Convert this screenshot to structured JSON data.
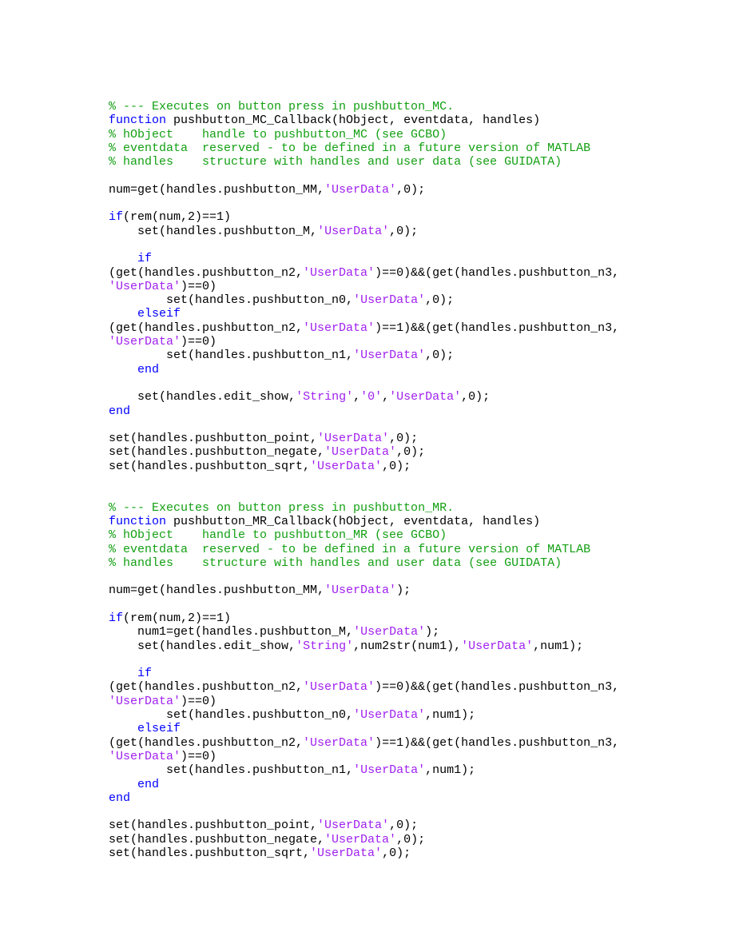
{
  "document": {
    "language": "MATLAB",
    "colors": {
      "background": "#ffffff",
      "plain": "#000000",
      "comment": "#13a013",
      "keyword": "#0000ff",
      "string": "#a020f0"
    }
  },
  "lines": [
    {
      "id": 1,
      "indent": "",
      "segments": [
        {
          "t": "comment",
          "s": "% --- Executes on button press in pushbutton_MC."
        }
      ]
    },
    {
      "id": 2,
      "indent": "",
      "segments": [
        {
          "t": "keyword",
          "s": "function"
        },
        {
          "t": "plain",
          "s": " pushbutton_MC_Callback(hObject, eventdata, handles)"
        }
      ]
    },
    {
      "id": 3,
      "indent": "",
      "segments": [
        {
          "t": "comment",
          "s": "% hObject    handle to pushbutton_MC (see GCBO)"
        }
      ]
    },
    {
      "id": 4,
      "indent": "",
      "segments": [
        {
          "t": "comment",
          "s": "% eventdata  reserved - to be defined in a future version of MATLAB"
        }
      ]
    },
    {
      "id": 5,
      "indent": "",
      "segments": [
        {
          "t": "comment",
          "s": "% handles    structure with handles and user data (see GUIDATA)"
        }
      ]
    },
    {
      "id": 6,
      "indent": "",
      "blank": true,
      "segments": [
        {
          "t": "plain",
          "s": ""
        }
      ]
    },
    {
      "id": 7,
      "indent": "",
      "segments": [
        {
          "t": "plain",
          "s": "num=get(handles.pushbutton_MM,"
        },
        {
          "t": "string",
          "s": "'UserData'"
        },
        {
          "t": "plain",
          "s": ",0);"
        }
      ]
    },
    {
      "id": 8,
      "indent": "",
      "blank": true,
      "segments": [
        {
          "t": "plain",
          "s": ""
        }
      ]
    },
    {
      "id": 9,
      "indent": "",
      "segments": [
        {
          "t": "keyword",
          "s": "if"
        },
        {
          "t": "plain",
          "s": "(rem(num,2)==1)"
        }
      ]
    },
    {
      "id": 10,
      "indent": "    ",
      "segments": [
        {
          "t": "plain",
          "s": "set(handles.pushbutton_M,"
        },
        {
          "t": "string",
          "s": "'UserData'"
        },
        {
          "t": "plain",
          "s": ",0);"
        }
      ]
    },
    {
      "id": 11,
      "indent": "",
      "blank": true,
      "segments": [
        {
          "t": "plain",
          "s": ""
        }
      ]
    },
    {
      "id": 12,
      "indent": "    ",
      "segments": [
        {
          "t": "keyword",
          "s": "if"
        }
      ]
    },
    {
      "id": 13,
      "indent": "",
      "segments": [
        {
          "t": "plain",
          "s": "(get(handles.pushbutton_n2,"
        },
        {
          "t": "string",
          "s": "'UserData'"
        },
        {
          "t": "plain",
          "s": ")==0)&&(get(handles.pushbutton_n3,"
        }
      ]
    },
    {
      "id": 14,
      "indent": "",
      "segments": [
        {
          "t": "string",
          "s": "'UserData'"
        },
        {
          "t": "plain",
          "s": ")==0)"
        }
      ]
    },
    {
      "id": 15,
      "indent": "        ",
      "segments": [
        {
          "t": "plain",
          "s": "set(handles.pushbutton_n0,"
        },
        {
          "t": "string",
          "s": "'UserData'"
        },
        {
          "t": "plain",
          "s": ",0);"
        }
      ]
    },
    {
      "id": 16,
      "indent": "    ",
      "segments": [
        {
          "t": "keyword",
          "s": "elseif"
        }
      ]
    },
    {
      "id": 17,
      "indent": "",
      "segments": [
        {
          "t": "plain",
          "s": "(get(handles.pushbutton_n2,"
        },
        {
          "t": "string",
          "s": "'UserData'"
        },
        {
          "t": "plain",
          "s": ")==1)&&(get(handles.pushbutton_n3,"
        }
      ]
    },
    {
      "id": 18,
      "indent": "",
      "segments": [
        {
          "t": "string",
          "s": "'UserData'"
        },
        {
          "t": "plain",
          "s": ")==0)"
        }
      ]
    },
    {
      "id": 19,
      "indent": "        ",
      "segments": [
        {
          "t": "plain",
          "s": "set(handles.pushbutton_n1,"
        },
        {
          "t": "string",
          "s": "'UserData'"
        },
        {
          "t": "plain",
          "s": ",0);"
        }
      ]
    },
    {
      "id": 20,
      "indent": "    ",
      "segments": [
        {
          "t": "keyword",
          "s": "end"
        }
      ]
    },
    {
      "id": 21,
      "indent": "",
      "blank": true,
      "segments": [
        {
          "t": "plain",
          "s": ""
        }
      ]
    },
    {
      "id": 22,
      "indent": "    ",
      "segments": [
        {
          "t": "plain",
          "s": "set(handles.edit_show,"
        },
        {
          "t": "string",
          "s": "'String'"
        },
        {
          "t": "plain",
          "s": ","
        },
        {
          "t": "string",
          "s": "'0'"
        },
        {
          "t": "plain",
          "s": ","
        },
        {
          "t": "string",
          "s": "'UserData'"
        },
        {
          "t": "plain",
          "s": ",0);"
        }
      ]
    },
    {
      "id": 23,
      "indent": "",
      "segments": [
        {
          "t": "keyword",
          "s": "end"
        }
      ]
    },
    {
      "id": 24,
      "indent": "",
      "blank": true,
      "segments": [
        {
          "t": "plain",
          "s": ""
        }
      ]
    },
    {
      "id": 25,
      "indent": "",
      "segments": [
        {
          "t": "plain",
          "s": "set(handles.pushbutton_point,"
        },
        {
          "t": "string",
          "s": "'UserData'"
        },
        {
          "t": "plain",
          "s": ",0);"
        }
      ]
    },
    {
      "id": 26,
      "indent": "",
      "segments": [
        {
          "t": "plain",
          "s": "set(handles.pushbutton_negate,"
        },
        {
          "t": "string",
          "s": "'UserData'"
        },
        {
          "t": "plain",
          "s": ",0);"
        }
      ]
    },
    {
      "id": 27,
      "indent": "",
      "segments": [
        {
          "t": "plain",
          "s": "set(handles.pushbutton_sqrt,"
        },
        {
          "t": "string",
          "s": "'UserData'"
        },
        {
          "t": "plain",
          "s": ",0);"
        }
      ]
    },
    {
      "id": 28,
      "indent": "",
      "blank": true,
      "segments": [
        {
          "t": "plain",
          "s": ""
        }
      ]
    },
    {
      "id": 29,
      "indent": "",
      "blank": true,
      "segments": [
        {
          "t": "plain",
          "s": ""
        }
      ]
    },
    {
      "id": 30,
      "indent": "",
      "segments": [
        {
          "t": "comment",
          "s": "% --- Executes on button press in pushbutton_MR."
        }
      ]
    },
    {
      "id": 31,
      "indent": "",
      "segments": [
        {
          "t": "keyword",
          "s": "function"
        },
        {
          "t": "plain",
          "s": " pushbutton_MR_Callback(hObject, eventdata, handles)"
        }
      ]
    },
    {
      "id": 32,
      "indent": "",
      "segments": [
        {
          "t": "comment",
          "s": "% hObject    handle to pushbutton_MR (see GCBO)"
        }
      ]
    },
    {
      "id": 33,
      "indent": "",
      "segments": [
        {
          "t": "comment",
          "s": "% eventdata  reserved - to be defined in a future version of MATLAB"
        }
      ]
    },
    {
      "id": 34,
      "indent": "",
      "segments": [
        {
          "t": "comment",
          "s": "% handles    structure with handles and user data (see GUIDATA)"
        }
      ]
    },
    {
      "id": 35,
      "indent": "",
      "blank": true,
      "segments": [
        {
          "t": "plain",
          "s": ""
        }
      ]
    },
    {
      "id": 36,
      "indent": "",
      "segments": [
        {
          "t": "plain",
          "s": "num=get(handles.pushbutton_MM,"
        },
        {
          "t": "string",
          "s": "'UserData'"
        },
        {
          "t": "plain",
          "s": ");"
        }
      ]
    },
    {
      "id": 37,
      "indent": "",
      "blank": true,
      "segments": [
        {
          "t": "plain",
          "s": ""
        }
      ]
    },
    {
      "id": 38,
      "indent": "",
      "segments": [
        {
          "t": "keyword",
          "s": "if"
        },
        {
          "t": "plain",
          "s": "(rem(num,2)==1)"
        }
      ]
    },
    {
      "id": 39,
      "indent": "    ",
      "segments": [
        {
          "t": "plain",
          "s": "num1=get(handles.pushbutton_M,"
        },
        {
          "t": "string",
          "s": "'UserData'"
        },
        {
          "t": "plain",
          "s": ");"
        }
      ]
    },
    {
      "id": 40,
      "indent": "    ",
      "segments": [
        {
          "t": "plain",
          "s": "set(handles.edit_show,"
        },
        {
          "t": "string",
          "s": "'String'"
        },
        {
          "t": "plain",
          "s": ",num2str(num1),"
        },
        {
          "t": "string",
          "s": "'UserData'"
        },
        {
          "t": "plain",
          "s": ",num1);"
        }
      ]
    },
    {
      "id": 41,
      "indent": "",
      "blank": true,
      "segments": [
        {
          "t": "plain",
          "s": ""
        }
      ]
    },
    {
      "id": 42,
      "indent": "    ",
      "segments": [
        {
          "t": "keyword",
          "s": "if"
        }
      ]
    },
    {
      "id": 43,
      "indent": "",
      "segments": [
        {
          "t": "plain",
          "s": "(get(handles.pushbutton_n2,"
        },
        {
          "t": "string",
          "s": "'UserData'"
        },
        {
          "t": "plain",
          "s": ")==0)&&(get(handles.pushbutton_n3,"
        }
      ]
    },
    {
      "id": 44,
      "indent": "",
      "segments": [
        {
          "t": "string",
          "s": "'UserData'"
        },
        {
          "t": "plain",
          "s": ")==0)"
        }
      ]
    },
    {
      "id": 45,
      "indent": "        ",
      "segments": [
        {
          "t": "plain",
          "s": "set(handles.pushbutton_n0,"
        },
        {
          "t": "string",
          "s": "'UserData'"
        },
        {
          "t": "plain",
          "s": ",num1);"
        }
      ]
    },
    {
      "id": 46,
      "indent": "    ",
      "segments": [
        {
          "t": "keyword",
          "s": "elseif"
        }
      ]
    },
    {
      "id": 47,
      "indent": "",
      "segments": [
        {
          "t": "plain",
          "s": "(get(handles.pushbutton_n2,"
        },
        {
          "t": "string",
          "s": "'UserData'"
        },
        {
          "t": "plain",
          "s": ")==1)&&(get(handles.pushbutton_n3,"
        }
      ]
    },
    {
      "id": 48,
      "indent": "",
      "segments": [
        {
          "t": "string",
          "s": "'UserData'"
        },
        {
          "t": "plain",
          "s": ")==0)"
        }
      ]
    },
    {
      "id": 49,
      "indent": "        ",
      "segments": [
        {
          "t": "plain",
          "s": "set(handles.pushbutton_n1,"
        },
        {
          "t": "string",
          "s": "'UserData'"
        },
        {
          "t": "plain",
          "s": ",num1);"
        }
      ]
    },
    {
      "id": 50,
      "indent": "    ",
      "segments": [
        {
          "t": "keyword",
          "s": "end"
        }
      ]
    },
    {
      "id": 51,
      "indent": "",
      "segments": [
        {
          "t": "keyword",
          "s": "end"
        }
      ]
    },
    {
      "id": 52,
      "indent": "",
      "blank": true,
      "segments": [
        {
          "t": "plain",
          "s": ""
        }
      ]
    },
    {
      "id": 53,
      "indent": "",
      "segments": [
        {
          "t": "plain",
          "s": "set(handles.pushbutton_point,"
        },
        {
          "t": "string",
          "s": "'UserData'"
        },
        {
          "t": "plain",
          "s": ",0);"
        }
      ]
    },
    {
      "id": 54,
      "indent": "",
      "segments": [
        {
          "t": "plain",
          "s": "set(handles.pushbutton_negate,"
        },
        {
          "t": "string",
          "s": "'UserData'"
        },
        {
          "t": "plain",
          "s": ",0);"
        }
      ]
    },
    {
      "id": 55,
      "indent": "",
      "segments": [
        {
          "t": "plain",
          "s": "set(handles.pushbutton_sqrt,"
        },
        {
          "t": "string",
          "s": "'UserData'"
        },
        {
          "t": "plain",
          "s": ",0);"
        }
      ]
    }
  ]
}
